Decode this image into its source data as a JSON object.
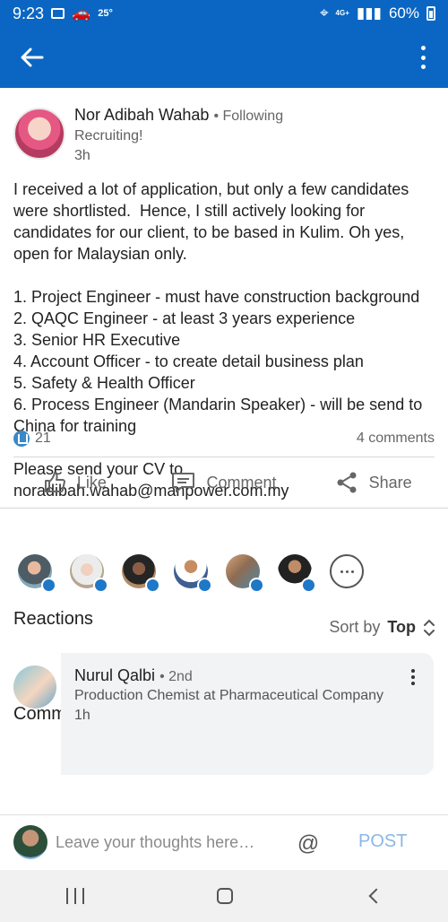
{
  "status_bar": {
    "time": "9:23",
    "temperature": "25°",
    "network": "4G+",
    "battery": "60%"
  },
  "app_bar": {
    "back_icon": "back-arrow-icon",
    "menu_icon": "vertical-dots-icon",
    "background_color": "#0a66c2"
  },
  "post": {
    "author_name": "Nor Adibah Wahab",
    "follow_status": "Following",
    "headline": "Recruiting!",
    "time": "3h",
    "body": [
      "I received a lot of application, but only a few candidates were shortlisted.  Hence, I still actively looking for candidates for our client, to be based in Kulim. Oh yes, open for Malaysian only.",
      "1. Project Engineer - must have construction background\n2. QAQC Engineer - at least 3 years experience\n3. Senior HR Executive\n4. Account Officer - to create detail business plan\n5. Safety & Health Officer\n6. Process Engineer (Mandarin Speaker) - will be send to China for training",
      "Please send your CV to noradibah.wahab@manpower.com.my"
    ],
    "reaction_count": "21",
    "comments_count": "4 comments"
  },
  "actions": [
    {
      "label": "Like",
      "icon": "thumbs-up-icon"
    },
    {
      "label": "Comment",
      "icon": "comment-icon"
    },
    {
      "label": "Share",
      "icon": "share-icon"
    }
  ],
  "reactions": {
    "title": "Reactions",
    "more_icon": "ellipsis-icon",
    "avatars": [
      {
        "icon": "avatar-photo-icon"
      },
      {
        "icon": "avatar-photo-icon"
      },
      {
        "icon": "avatar-photo-icon"
      },
      {
        "icon": "avatar-photo-icon"
      },
      {
        "icon": "avatar-photo-icon"
      },
      {
        "icon": "avatar-photo-icon"
      }
    ]
  },
  "comments": {
    "title": "Comments",
    "sort_prefix": "Sort by",
    "sort_value": "Top",
    "items": [
      {
        "name": "Nurul Qalbi",
        "degree": "2nd",
        "headline": "Production Chemist at Pharmaceutical Company",
        "time": "1h"
      }
    ]
  },
  "composer": {
    "placeholder": "Leave your thoughts here…",
    "mention_icon": "at-icon",
    "post_label": "POST"
  },
  "system_nav": {
    "icons": [
      "recents-icon",
      "home-icon",
      "back-icon"
    ]
  }
}
